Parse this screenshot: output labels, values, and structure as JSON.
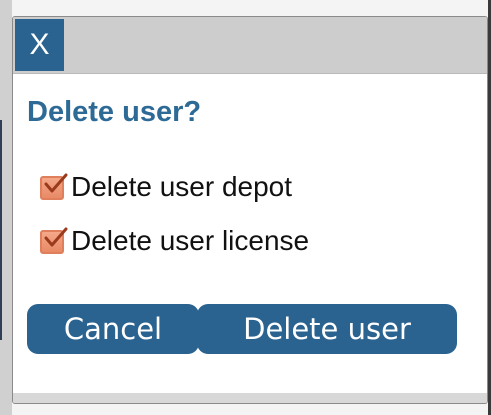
{
  "dialog": {
    "close_label": "X",
    "title": "Delete user?",
    "options": [
      {
        "label": "Delete user depot",
        "checked": true
      },
      {
        "label": "Delete user license",
        "checked": true
      }
    ],
    "buttons": {
      "cancel": "Cancel",
      "delete": "Delete user"
    }
  },
  "colors": {
    "accent": "#2a6390",
    "title": "#2d6a96",
    "checkbox": "#e88a66",
    "titlebar": "#cdcdcd"
  },
  "icons": {
    "close": "close-icon",
    "check": "checkmark-icon"
  }
}
